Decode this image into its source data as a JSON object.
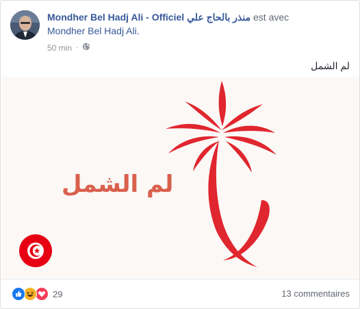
{
  "post": {
    "page_name": "Mondher Bel Hadj Ali - Officiel",
    "page_name_arabic": "منذر بالحاج علي",
    "with_text": "est avec",
    "tagged_user": "Mondher Bel Hadj Ali.",
    "timestamp": "50 min",
    "privacy_icon": "globe-icon",
    "text": "لم الشمل"
  },
  "image": {
    "slogan": "لم الشمل",
    "logo_icon": "palm-tree-icon",
    "flag_icon": "tunisia-flag-icon",
    "colors": {
      "background": "#fbf8f6",
      "palm_red": "#e0262e",
      "slogan": "#d9604d"
    }
  },
  "footer": {
    "reaction_icons": [
      "like-icon",
      "haha-icon",
      "love-icon"
    ],
    "reaction_count": "29",
    "comments": "13 commentaires"
  },
  "colors": {
    "link": "#365899",
    "meta": "#90949c",
    "like": "#1877f2",
    "love": "#f33e58",
    "haha": "#f7b125"
  }
}
